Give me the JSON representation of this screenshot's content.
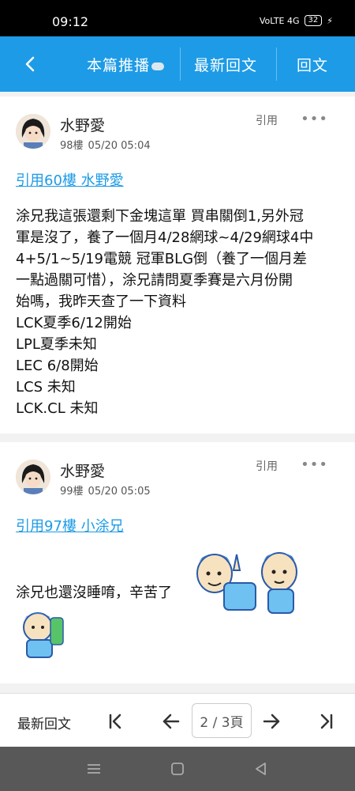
{
  "status_bar": {
    "time": "09:12",
    "indicators": "VoLTE 4G",
    "battery": "32"
  },
  "header": {
    "tab_recommend": "本篇推播",
    "tab_latest": "最新回文",
    "tab_reply": "回文"
  },
  "posts": [
    {
      "author": "水野愛",
      "floor": "98樓",
      "time": "05/20 05:04",
      "cite_label": "引用",
      "more": "•••",
      "quote_link": "引用60樓 水野愛",
      "body": "涂兄我這張還剩下金塊這單 買串關倒1,另外冠\n軍是沒了，養了一個月4/28網球~4/29網球4中\n4+5/1~5/19電競 冠軍BLG倒（養了一個月差\n一點過關可惜），涂兄請問夏季賽是六月份開\n始嗎，我昨天查了一下資料\nLCK夏季6/12開始\nLPL夏季未知\nLEC 6/8開始\nLCS 未知\nLCK.CL 未知"
    },
    {
      "author": "水野愛",
      "floor": "99樓",
      "time": "05/20 05:05",
      "cite_label": "引用",
      "more": "•••",
      "quote_link": "引用97樓 小涂兄",
      "body": "涂兄也還沒睡唷，辛苦了"
    }
  ],
  "bottom_bar": {
    "latest": "最新回文",
    "page_indicator": "2 / 3頁"
  },
  "colors": {
    "accent": "#1d9be6",
    "link": "#1d9be6"
  }
}
